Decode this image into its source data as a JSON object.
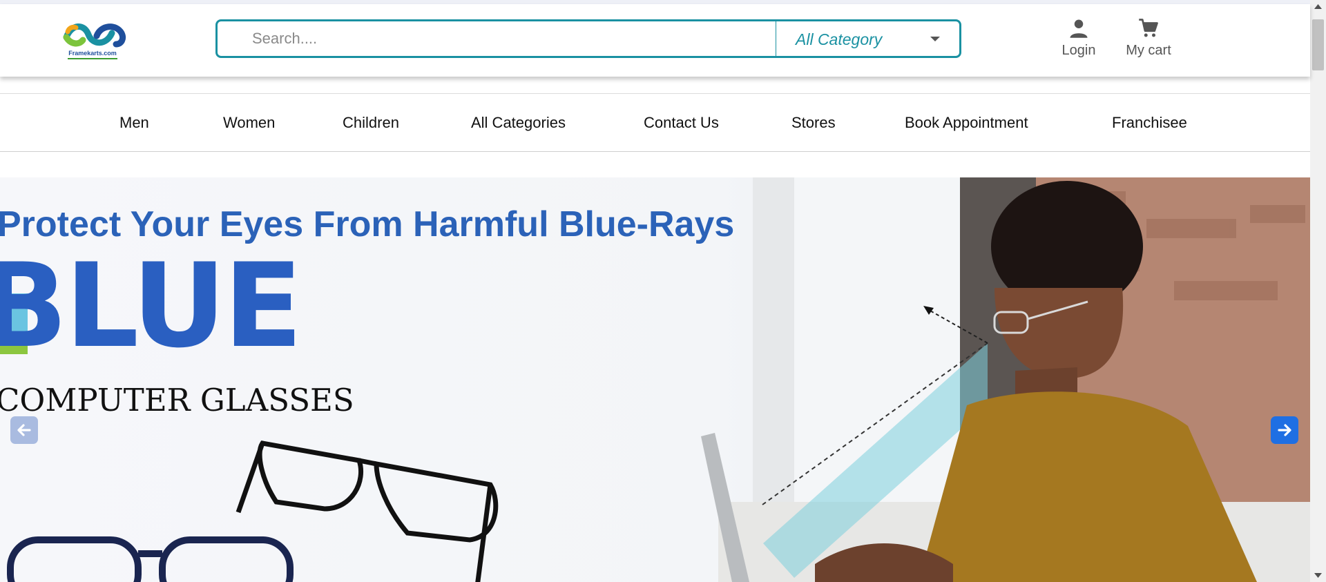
{
  "header": {
    "logo_text": "Framekarts.com",
    "search": {
      "placeholder": "Search...."
    },
    "category": {
      "selected": "All Category"
    },
    "login_label": "Login",
    "cart_label": "My cart"
  },
  "nav": {
    "items": [
      {
        "label": "Men"
      },
      {
        "label": "Women"
      },
      {
        "label": "Children"
      },
      {
        "label": "All Categories"
      },
      {
        "label": "Contact Us"
      },
      {
        "label": "Stores"
      },
      {
        "label": "Book Appointment"
      },
      {
        "label": "Franchisee"
      }
    ]
  },
  "hero": {
    "title": "Protect Your Eyes From Harmful Blue-Rays",
    "brand_word": "BLUE",
    "subtitle": "COMPUTER GLASSES"
  },
  "colors": {
    "accent_teal": "#1a91a2",
    "hero_blue": "#2b62b8",
    "next_button": "#1f6fe3",
    "prev_button": "#a9bbe0"
  },
  "icons": [
    "logo-icon",
    "chevron-down-icon",
    "person-icon",
    "cart-icon",
    "arrow-left-icon",
    "arrow-right-icon"
  ]
}
